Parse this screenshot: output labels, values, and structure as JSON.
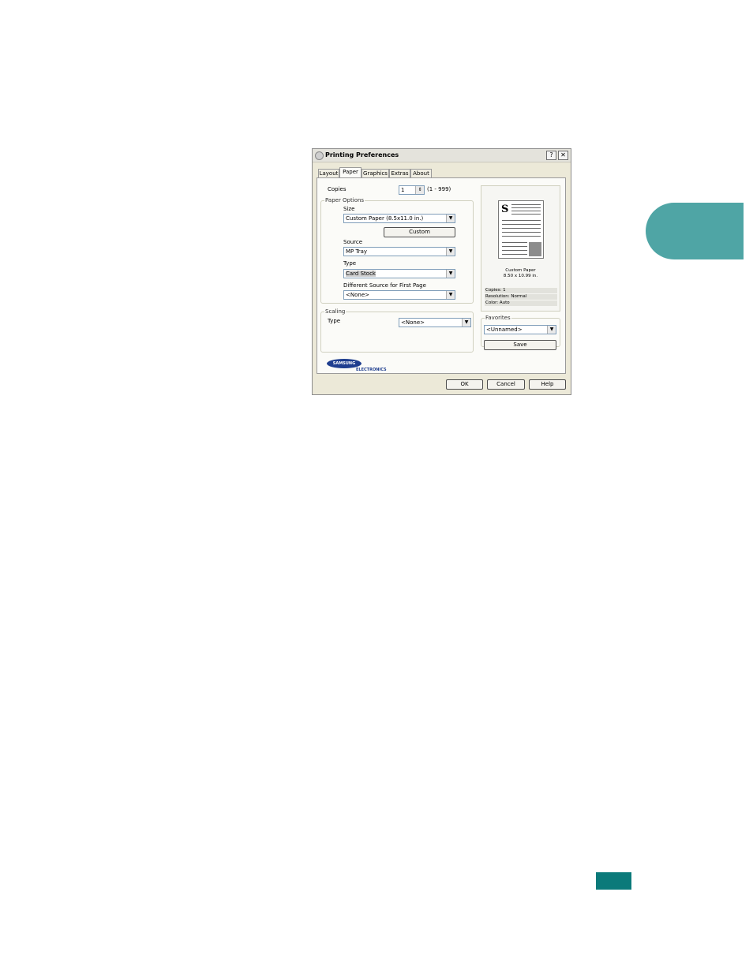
{
  "dialog": {
    "title": "Printing Preferences",
    "help_glyph": "?",
    "close_glyph": "✕",
    "tabs": [
      {
        "label": "Layout"
      },
      {
        "label": "Paper"
      },
      {
        "label": "Graphics"
      },
      {
        "label": "Extras"
      },
      {
        "label": "About"
      }
    ],
    "active_tab": "Paper",
    "copies": {
      "label": "Copies",
      "value": "1",
      "range": "(1 - 999)"
    },
    "paper_options": {
      "label": "Paper Options",
      "size_label": "Size",
      "size_value": "Custom Paper (8.5x11.0 in.)",
      "custom_button": "Custom",
      "source_label": "Source",
      "source_value": "MP Tray",
      "type_label": "Type",
      "type_value": "Card Stock",
      "first_page_label": "Different Source for First Page",
      "first_page_value": "<None>"
    },
    "scaling": {
      "label": "Scaling",
      "type_label": "Type",
      "type_value": "<None>"
    },
    "preview": {
      "logo_letter": "S",
      "paper_name": "Custom Paper",
      "paper_dims": "8.50 x 10.99 in.",
      "info": [
        "Copies: 1",
        "Resolution: Normal",
        "Color: Auto"
      ]
    },
    "favorites": {
      "label": "Favorites",
      "value": "<Unnamed>",
      "save_button": "Save"
    },
    "brand": {
      "name": "SAMSUNG",
      "sub": "ELECTRONICS"
    },
    "buttons": {
      "ok": "OK",
      "cancel": "Cancel",
      "help": "Help"
    }
  },
  "colors": {
    "chapter_tab": "#4fa5a5",
    "page_badge": "#0b7a7a"
  }
}
